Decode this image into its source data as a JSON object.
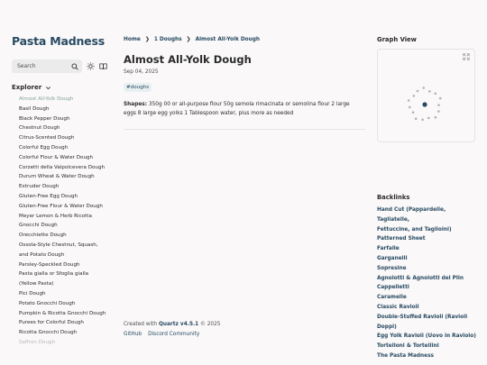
{
  "site": {
    "title": "Pasta Madness"
  },
  "search": {
    "label": "Search"
  },
  "explorer": {
    "title": "Explorer",
    "items": [
      "Almost All-Yolk Dough",
      "Basil Dough",
      "Black Pepper Dough",
      "Chestnut Dough",
      "Citrus-Scented Dough",
      "Colorful Egg Dough",
      "Colorful Flour & Water Dough",
      "Corzetti della Valpolcevera Dough",
      "Durum Wheat & Water Dough",
      "Extruder Dough",
      "Gluten-Free Egg Dough",
      "Gluten-Free Flour & Water Dough",
      "Meyer Lemon & Herb Ricotta",
      "Gnocchi Dough",
      "Orecchiette Dough",
      "Ossola-Style Chestnut, Squash,",
      "and Potato Dough",
      "Parsley-Speckled Dough",
      "Pasta gialla or Sfoglia gialla",
      "(Yellow Pasta)",
      "Pici Dough",
      "Potato Gnocchi Dough",
      "Pumpkin & Ricotta Gnocchi Dough",
      "Purees for Colorful Dough",
      "Ricotta Gnocchi Dough",
      "Saffron Dough"
    ]
  },
  "breadcrumb": {
    "home": "Home",
    "sep": "❯",
    "folder": "1 Doughs",
    "current": "Almost All-Yolk Dough"
  },
  "page": {
    "title": "Almost All-Yolk Dough",
    "date": "Sep 04, 2025",
    "tag": "#doughs",
    "shapes_label": "Shapes:",
    "shapes_text": " 350g 00 or all-purpose flour 50g semola rimacinata or semolina flour 2 large eggs 8 large egg yolks 1 Tablespoon water, plus more as needed"
  },
  "footer": {
    "created_prefix": "Created with ",
    "quartz": "Quartz v4.5.1",
    "year": " © 2025",
    "links": [
      "GitHub",
      "Discord Community"
    ]
  },
  "graph": {
    "title": "Graph View"
  },
  "backlinks": {
    "title": "Backlinks",
    "items": [
      "Hand Cut (Pappardelle, Tagliatelle,",
      "Fettuccine, and Taglioini)",
      "Patterned Sheet",
      "Farfalle",
      "Garganelli",
      "Sopresine",
      "Agnolotti & Agnolotti del Plin",
      "Cappelletti",
      "Caramelle",
      "Classic Ravioli",
      "Double-Stuffed Ravioli (Ravioli",
      "Doppi)",
      "Egg Yolk Ravioli (Uovo in Raviolo)",
      "Tortelloni & Tortellini",
      "The Pasta Madness"
    ]
  },
  "colors": {
    "accent": "#284b63",
    "active": "#84a59d",
    "node": "#b3b3b3",
    "current_node": "#284b63"
  }
}
